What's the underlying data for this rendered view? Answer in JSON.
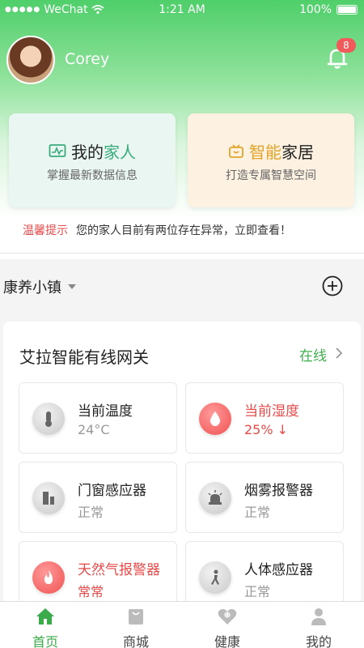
{
  "status_bar": {
    "carrier": "WeChat",
    "time": "1:21 AM",
    "battery": "100%"
  },
  "user": {
    "name": "Corey",
    "notification_count": "8"
  },
  "cards": [
    {
      "title_prefix": "我的",
      "title_highlight": "家人",
      "subtitle": "掌握最新数据信息",
      "icon": "chart-monitor-icon"
    },
    {
      "title_highlight": "智能",
      "title_suffix": "家居",
      "subtitle": "打造专属智慧空间",
      "icon": "tv-icon"
    }
  ],
  "tip": {
    "label": "温馨提示",
    "message": "您的家人目前有两位存在异常，立即查看！"
  },
  "location": {
    "name": "康养小镇"
  },
  "gateway": {
    "title": "艾拉智能有线网关",
    "status": "在线"
  },
  "devices": [
    {
      "name": "当前温度",
      "value": "24°C",
      "icon": "thermometer-icon",
      "alert": false
    },
    {
      "name": "当前湿度",
      "value": "25% ↓",
      "icon": "humidity-drop-icon",
      "alert": true
    },
    {
      "name": "门窗感应器",
      "value": "正常",
      "icon": "door-sensor-icon",
      "alert": false
    },
    {
      "name": "烟雾报警器",
      "value": "正常",
      "icon": "smoke-alarm-icon",
      "alert": false
    },
    {
      "name": "天然气报警器",
      "value": "常常",
      "icon": "gas-flame-icon",
      "alert": true
    },
    {
      "name": "人体感应器",
      "value": "正常",
      "icon": "person-walking-icon",
      "alert": false
    }
  ],
  "tabs": [
    {
      "label": "首页",
      "icon": "home-icon",
      "active": true
    },
    {
      "label": "商城",
      "icon": "shopping-bag-icon",
      "active": false
    },
    {
      "label": "健康",
      "icon": "health-heart-icon",
      "active": false
    },
    {
      "label": "我的",
      "icon": "person-icon",
      "active": false
    }
  ],
  "colors": {
    "primary_green": "#3aaa4a",
    "alert_red": "#e84a4a",
    "card_family_bg": "#e9f6f2",
    "card_home_bg": "#fdf1e1"
  }
}
